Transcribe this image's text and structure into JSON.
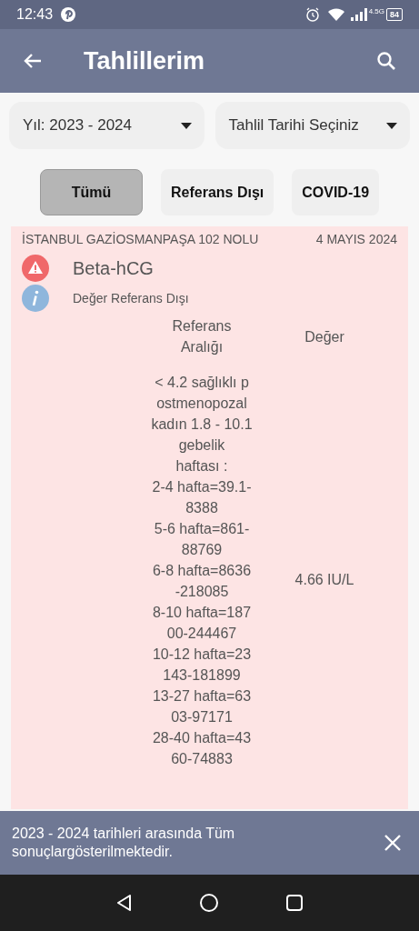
{
  "status_bar": {
    "time": "12:43",
    "network": "4.5G",
    "battery": "84"
  },
  "app_bar": {
    "title": "Tahlillerim"
  },
  "dropdowns": [
    {
      "label": "Yıl: 2023 - 2024"
    },
    {
      "label": "Tahlil Tarihi Seçiniz"
    }
  ],
  "filters": [
    {
      "label": "Tümü",
      "selected": true
    },
    {
      "label": "Referans Dışı",
      "selected": false
    },
    {
      "label": "COVID-19",
      "selected": false
    }
  ],
  "results": [
    {
      "lab": "İSTANBUL GAZİOSMANPAŞA 102 NOLU",
      "date": "4 MAYIS 2024",
      "test": "Beta-hCG",
      "note": "Değer Referans Dışı",
      "out_of_range": true,
      "reference_header": "Referans Aralığı",
      "value_header": "Değer",
      "reference_lines": [
        "< 4.2 sağlıklı p",
        "ostmenopozal",
        "kadın 1.8 - 10.1",
        "gebelik",
        "haftası :",
        "2-4 hafta=39.1-",
        "8388",
        "5-6 hafta=861-",
        "88769",
        "6-8 hafta=8636",
        "-218085",
        "8-10 hafta=187",
        "00-244467",
        "10-12 hafta=23",
        "143-181899",
        "13-27 hafta=63",
        "03-97171",
        "28-40 hafta=43",
        "60-74883"
      ],
      "value": "4.66 IU/L"
    }
  ],
  "snackbar": {
    "message": "2023 - 2024 tarihleri arasında Tüm sonuçlargösterilmektedir."
  }
}
